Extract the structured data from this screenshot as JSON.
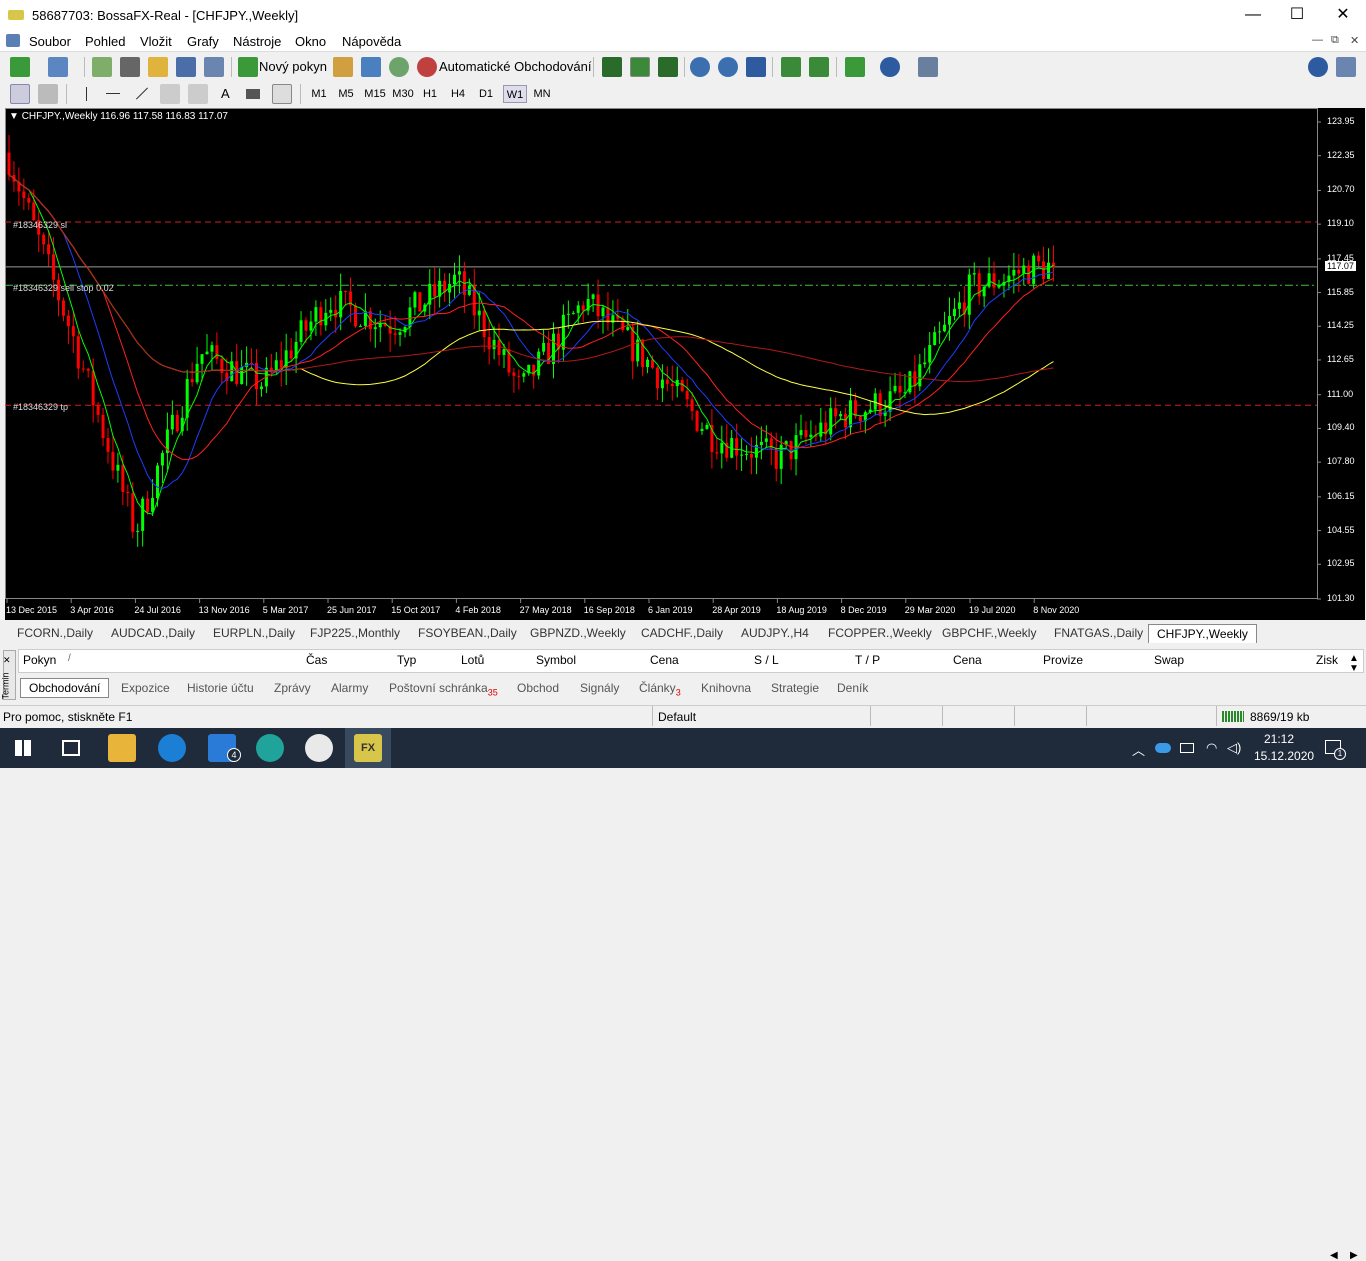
{
  "window": {
    "title": "58687703: BossaFX-Real - [CHFJPY.,Weekly]",
    "logo_text": "FX",
    "controls": [
      "—",
      "☐",
      "✕"
    ]
  },
  "menu": {
    "items": [
      "Soubor",
      "Pohled",
      "Vložit",
      "Grafy",
      "Nástroje",
      "Okno",
      "Nápověda"
    ],
    "mdi_controls": [
      "—",
      "⧉",
      "✕"
    ]
  },
  "toolbar": {
    "new_order": "Nový pokyn",
    "auto_trading": "Automatické Obchodování"
  },
  "timeframes": [
    "M1",
    "M5",
    "M15",
    "M30",
    "H1",
    "H4",
    "D1",
    "W1",
    "MN"
  ],
  "active_timeframe": "W1",
  "chart": {
    "header": "CHFJPY.,Weekly  116.96 117.58 116.83 117.07",
    "current_price": "117.07",
    "line_labels": {
      "sl": "#18346329 sl",
      "entry": "#18346329 sell stop 0.02",
      "tp": "#18346329 tp"
    },
    "colors": {
      "background": "#000000",
      "bull": "#00ff00",
      "bear": "#ff0000",
      "ma_fast": "#00ff00",
      "ma_blue": "#1e3cff",
      "ma_red": "#ff2020",
      "ma_yellow": "#ffff40"
    }
  },
  "chart_data": {
    "type": "candlestick",
    "symbol": "CHFJPY.",
    "timeframe": "Weekly",
    "ohlc_last": {
      "open": 116.96,
      "high": 117.58,
      "low": 116.83,
      "close": 117.07
    },
    "y_ticks": [
      "123.95",
      "122.35",
      "120.70",
      "119.10",
      "117.45",
      "115.85",
      "114.25",
      "112.65",
      "111.00",
      "109.40",
      "107.80",
      "106.15",
      "104.55",
      "102.95",
      "101.30"
    ],
    "x_ticks": [
      "13 Dec 2015",
      "3 Apr 2016",
      "24 Jul 2016",
      "13 Nov 2016",
      "5 Mar 2017",
      "25 Jun 2017",
      "15 Oct 2017",
      "4 Feb 2018",
      "27 May 2018",
      "16 Sep 2018",
      "6 Jan 2019",
      "28 Apr 2019",
      "18 Aug 2019",
      "8 Dec 2019",
      "29 Mar 2020",
      "19 Jul 2020",
      "8 Nov 2020"
    ],
    "ylim": [
      101.3,
      123.95
    ],
    "horizontal_lines": [
      {
        "label": "#18346329 sl",
        "value": 119.2
      },
      {
        "label": "#18346329 sell stop 0.02",
        "value": 116.2
      },
      {
        "label": "#18346329 tp",
        "value": 110.5
      }
    ],
    "price_anchors": [
      {
        "x": "13 Dec 2015",
        "price": 122.5
      },
      {
        "x": "3 Apr 2016",
        "price": 114.0
      },
      {
        "x": "24 Jul 2016",
        "price": 104.5
      },
      {
        "x": "13 Nov 2016",
        "price": 113.0
      },
      {
        "x": "5 Mar 2017",
        "price": 111.5
      },
      {
        "x": "25 Jun 2017",
        "price": 115.5
      },
      {
        "x": "15 Oct 2017",
        "price": 114.3
      },
      {
        "x": "4 Feb 2018",
        "price": 116.5
      },
      {
        "x": "27 May 2018",
        "price": 111.2
      },
      {
        "x": "16 Sep 2018",
        "price": 115.5
      },
      {
        "x": "6 Jan 2019",
        "price": 112.5
      },
      {
        "x": "28 Apr 2019",
        "price": 109.0
      },
      {
        "x": "18 Aug 2019",
        "price": 108.0
      },
      {
        "x": "8 Dec 2019",
        "price": 110.0
      },
      {
        "x": "29 Mar 2020",
        "price": 111.0
      },
      {
        "x": "19 Jul 2020",
        "price": 116.0
      },
      {
        "x": "8 Nov 2020",
        "price": 117.07
      }
    ]
  },
  "chart_tabs": [
    "FCORN.,Daily",
    "AUDCAD.,Daily",
    "EURPLN.,Daily",
    "FJP225.,Monthly",
    "FSOYBEAN.,Daily",
    "GBPNZD.,Weekly",
    "CADCHF.,Daily",
    "AUDJPY.,H4",
    "FCOPPER.,Weekly",
    "GBPCHF.,Weekly",
    "FNATGAS.,Daily",
    "CHFJPY.,Weekly"
  ],
  "active_chart_tab": "CHFJPY.,Weekly",
  "terminal": {
    "side_label": "Termin",
    "columns": [
      "Pokyn",
      "/",
      "Čas",
      "Typ",
      "Lotů",
      "Symbol",
      "Cena",
      "S / L",
      "T / P",
      "Cena",
      "Provize",
      "Swap",
      "Zisk"
    ],
    "tabs": [
      {
        "label": "Obchodování",
        "badge": ""
      },
      {
        "label": "Expozice",
        "badge": ""
      },
      {
        "label": "Historie účtu",
        "badge": ""
      },
      {
        "label": "Zprávy",
        "badge": ""
      },
      {
        "label": "Alarmy",
        "badge": ""
      },
      {
        "label": "Poštovní schránka",
        "badge": "35"
      },
      {
        "label": "Obchod",
        "badge": ""
      },
      {
        "label": "Signály",
        "badge": ""
      },
      {
        "label": "Články",
        "badge": "3"
      },
      {
        "label": "Knihovna",
        "badge": ""
      },
      {
        "label": "Strategie",
        "badge": ""
      },
      {
        "label": "Deník",
        "badge": ""
      }
    ],
    "active_tab": "Obchodování"
  },
  "status": {
    "help": "Pro pomoc, stiskněte F1",
    "profile": "Default",
    "traffic": "8869/19 kb"
  },
  "taskbar": {
    "mail_badge": "4",
    "time": "21:12",
    "date": "15.12.2020",
    "notification_count": "1"
  }
}
